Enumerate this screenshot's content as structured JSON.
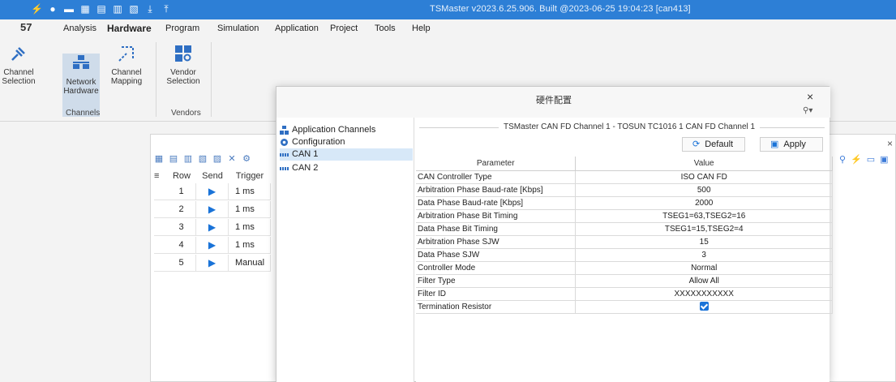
{
  "titlebar": {
    "title": "TSMaster v2023.6.25.906. Built @2023-06-25 19:04:23 [can413]",
    "quick_access_icons": [
      "lightning-icon",
      "record-icon",
      "chat-icon",
      "grid-icon",
      "save-icon",
      "layout-icon",
      "layout-add-icon",
      "download-icon",
      "upload-icon"
    ]
  },
  "menubar": {
    "logo": "57",
    "items": [
      "Analysis",
      "Hardware",
      "Program",
      "Simulation",
      "Application",
      "Project",
      "Tools",
      "Help"
    ],
    "active": "Hardware"
  },
  "ribbon": {
    "buttons": [
      {
        "label": "Channel Selection",
        "icon": "plug-icon"
      },
      {
        "label": "Network Hardware",
        "icon": "network-icon",
        "selected": true
      },
      {
        "label": "Channel Mapping",
        "icon": "mapping-icon"
      },
      {
        "label": "Vendor Selection",
        "icon": "vendor-icon"
      }
    ],
    "groups": [
      "Channels",
      "Vendors"
    ]
  },
  "background_panel": {
    "columns": [
      "Row",
      "Send",
      "Trigger"
    ],
    "rows": [
      {
        "row": "1",
        "trigger": "1 ms"
      },
      {
        "row": "2",
        "trigger": "1 ms"
      },
      {
        "row": "3",
        "trigger": "1 ms"
      },
      {
        "row": "4",
        "trigger": "1 ms"
      },
      {
        "row": "5",
        "trigger": "Manual"
      }
    ],
    "send_glyph": "▶",
    "close_glyph": "×"
  },
  "dialog": {
    "title": "硬件配置",
    "close_glyph": "×",
    "tree": [
      {
        "label": "Application Channels",
        "icon": "app-channels-icon"
      },
      {
        "label": "Configuration",
        "icon": "gear-icon"
      },
      {
        "label": "CAN 1",
        "icon": "can-icon",
        "selected": true
      },
      {
        "label": "CAN 2",
        "icon": "can-icon"
      }
    ],
    "group_title": "TSMaster CAN FD Channel 1 - TOSUN TC1016 1 CAN FD Channel 1",
    "default_label": "Default",
    "apply_label": "Apply",
    "table_headers": {
      "parameter": "Parameter",
      "value": "Value"
    },
    "params": [
      {
        "name": "CAN Controller Type",
        "value": "ISO CAN FD"
      },
      {
        "name": "Arbitration Phase Baud-rate [Kbps]",
        "value": "500"
      },
      {
        "name": "Data Phase Baud-rate [Kbps]",
        "value": "2000"
      },
      {
        "name": "Arbitration Phase Bit Timing",
        "value": "TSEG1=63,TSEG2=16"
      },
      {
        "name": "Data Phase Bit Timing",
        "value": "TSEG1=15,TSEG2=4"
      },
      {
        "name": "Arbitration Phase SJW",
        "value": "15"
      },
      {
        "name": "Data Phase SJW",
        "value": "3"
      },
      {
        "name": "Controller Mode",
        "value": "Normal"
      },
      {
        "name": "Filter Type",
        "value": "Allow All"
      },
      {
        "name": "Filter ID",
        "value": "XXXXXXXXXXX"
      },
      {
        "name": "Termination Resistor",
        "value": "",
        "checked": true
      }
    ]
  }
}
